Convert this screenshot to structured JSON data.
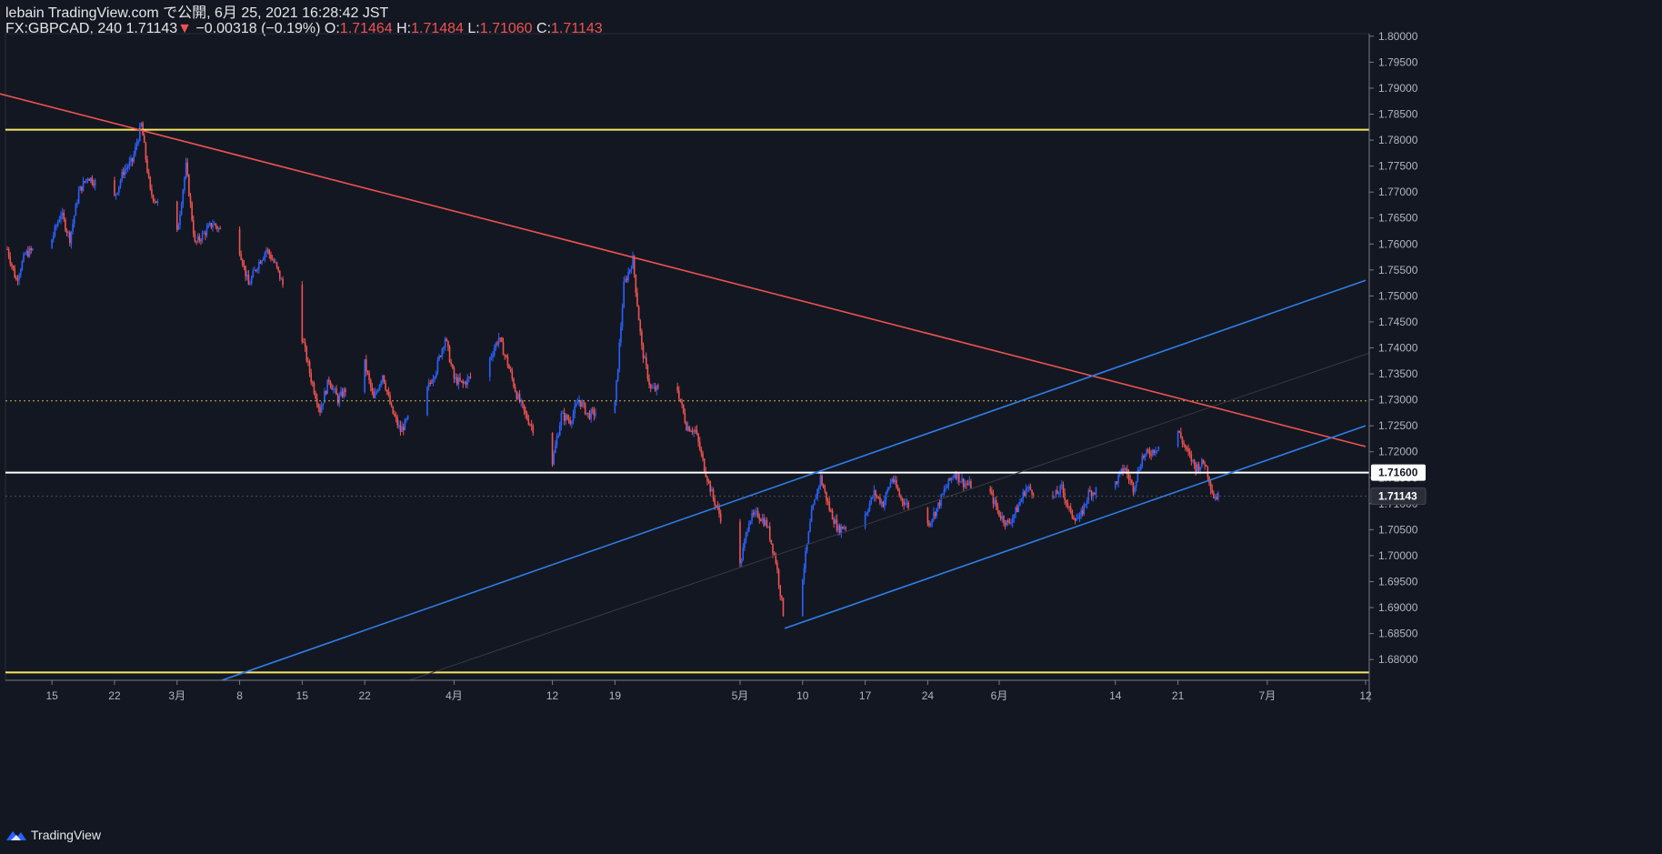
{
  "header": {
    "publisher": "lebain TradingView.com で公開, 6月 25, 2021 16:28:42 JST",
    "symbol": "FX:GBPCAD, 240",
    "last": "1.71143",
    "change": "−0.00318 (−0.19%)",
    "o_label": "O:",
    "o_value": "1.71464",
    "h_label": "H:",
    "h_value": "1.71484",
    "l_label": "L:",
    "l_value": "1.71060",
    "c_label": "C:",
    "c_value": "1.71143"
  },
  "footer": {
    "brand": "TradingView",
    "logo_icon": "tradingview-logo-icon"
  },
  "colors": {
    "background": "#131722",
    "up": "#2962ff",
    "down": "#ef5350",
    "support": "#f5e663",
    "channel": "#2f7ee6",
    "trendline": "#ef5350",
    "level": "#ffffff"
  },
  "chart_data": {
    "type": "candlestick",
    "symbol": "FX:GBPCAD",
    "interval": "240",
    "ylim": [
      1.676,
      1.8005
    ],
    "y_ticks": [
      "1.80000",
      "1.79500",
      "1.79000",
      "1.78500",
      "1.78000",
      "1.77500",
      "1.77000",
      "1.76500",
      "1.76000",
      "1.75500",
      "1.75000",
      "1.74500",
      "1.74000",
      "1.73500",
      "1.73000",
      "1.72500",
      "1.72000",
      "1.71500",
      "1.71000",
      "1.70500",
      "1.70000",
      "1.69500",
      "1.69000",
      "1.68500",
      "1.68000"
    ],
    "y_tick_values": [
      1.8,
      1.795,
      1.79,
      1.785,
      1.78,
      1.775,
      1.77,
      1.765,
      1.76,
      1.755,
      1.75,
      1.745,
      1.74,
      1.735,
      1.73,
      1.725,
      1.72,
      1.715,
      1.71,
      1.705,
      1.7,
      1.695,
      1.69,
      1.685,
      1.68
    ],
    "x_ticks": [
      {
        "label": "15",
        "date": "2021-02-15"
      },
      {
        "label": "22",
        "date": "2021-02-22"
      },
      {
        "label": "3月",
        "date": "2021-03-01"
      },
      {
        "label": "8",
        "date": "2021-03-08"
      },
      {
        "label": "15",
        "date": "2021-03-15"
      },
      {
        "label": "22",
        "date": "2021-03-22"
      },
      {
        "label": "4月",
        "date": "2021-04-01"
      },
      {
        "label": "12",
        "date": "2021-04-12"
      },
      {
        "label": "19",
        "date": "2021-04-19"
      },
      {
        "label": "5月",
        "date": "2021-05-03"
      },
      {
        "label": "10",
        "date": "2021-05-10"
      },
      {
        "label": "17",
        "date": "2021-05-17"
      },
      {
        "label": "24",
        "date": "2021-05-24"
      },
      {
        "label": "6月",
        "date": "2021-06-01"
      },
      {
        "label": "14",
        "date": "2021-06-14"
      },
      {
        "label": "21",
        "date": "2021-06-21"
      },
      {
        "label": "7月",
        "date": "2021-07-01"
      },
      {
        "label": "12",
        "date": "2021-07-12"
      }
    ],
    "price_path": [
      [
        "2021-02-10",
        1.759
      ],
      [
        "2021-02-11",
        1.753
      ],
      [
        "2021-02-12",
        1.758
      ],
      [
        "2021-02-15",
        1.761
      ],
      [
        "2021-02-16",
        1.766
      ],
      [
        "2021-02-17",
        1.761
      ],
      [
        "2021-02-18",
        1.77
      ],
      [
        "2021-02-19",
        1.773
      ],
      [
        "2021-02-22",
        1.769
      ],
      [
        "2021-02-23",
        1.774
      ],
      [
        "2021-02-24",
        1.776
      ],
      [
        "2021-02-25",
        1.783
      ],
      [
        "2021-02-26",
        1.77
      ],
      [
        "2021-03-01",
        1.762
      ],
      [
        "2021-03-02",
        1.775
      ],
      [
        "2021-03-03",
        1.76
      ],
      [
        "2021-03-04",
        1.762
      ],
      [
        "2021-03-05",
        1.764
      ],
      [
        "2021-03-08",
        1.759
      ],
      [
        "2021-03-09",
        1.752
      ],
      [
        "2021-03-10",
        1.756
      ],
      [
        "2021-03-11",
        1.759
      ],
      [
        "2021-03-12",
        1.756
      ],
      [
        "2021-03-15",
        1.742
      ],
      [
        "2021-03-16",
        1.734
      ],
      [
        "2021-03-17",
        1.728
      ],
      [
        "2021-03-18",
        1.734
      ],
      [
        "2021-03-19",
        1.73
      ],
      [
        "2021-03-22",
        1.737
      ],
      [
        "2021-03-23",
        1.73
      ],
      [
        "2021-03-24",
        1.735
      ],
      [
        "2021-03-25",
        1.728
      ],
      [
        "2021-03-26",
        1.724
      ],
      [
        "2021-03-29",
        1.732
      ],
      [
        "2021-03-30",
        1.736
      ],
      [
        "2021-03-31",
        1.742
      ],
      [
        "2021-04-01",
        1.734
      ],
      [
        "2021-04-02",
        1.733
      ],
      [
        "2021-04-05",
        1.738
      ],
      [
        "2021-04-06",
        1.742
      ],
      [
        "2021-04-07",
        1.737
      ],
      [
        "2021-04-08",
        1.731
      ],
      [
        "2021-04-09",
        1.727
      ],
      [
        "2021-04-12",
        1.718
      ],
      [
        "2021-04-13",
        1.727
      ],
      [
        "2021-04-14",
        1.726
      ],
      [
        "2021-04-15",
        1.73
      ],
      [
        "2021-04-16",
        1.727
      ],
      [
        "2021-04-19",
        1.729
      ],
      [
        "2021-04-20",
        1.752
      ],
      [
        "2021-04-21",
        1.757
      ],
      [
        "2021-04-22",
        1.74
      ],
      [
        "2021-04-23",
        1.732
      ],
      [
        "2021-04-26",
        1.732
      ],
      [
        "2021-04-27",
        1.725
      ],
      [
        "2021-04-28",
        1.724
      ],
      [
        "2021-04-29",
        1.717
      ],
      [
        "2021-04-30",
        1.711
      ],
      [
        "2021-05-03",
        1.698
      ],
      [
        "2021-05-04",
        1.707
      ],
      [
        "2021-05-05",
        1.708
      ],
      [
        "2021-05-06",
        1.706
      ],
      [
        "2021-05-07",
        1.699
      ],
      [
        "2021-05-08",
        1.687
      ],
      [
        "2021-05-10",
        1.696
      ],
      [
        "2021-05-11",
        1.708
      ],
      [
        "2021-05-12",
        1.715
      ],
      [
        "2021-05-13",
        1.709
      ],
      [
        "2021-05-14",
        1.705
      ],
      [
        "2021-05-17",
        1.708
      ],
      [
        "2021-05-18",
        1.712
      ],
      [
        "2021-05-19",
        1.71
      ],
      [
        "2021-05-20",
        1.715
      ],
      [
        "2021-05-21",
        1.711
      ],
      [
        "2021-05-24",
        1.706
      ],
      [
        "2021-05-25",
        1.709
      ],
      [
        "2021-05-26",
        1.713
      ],
      [
        "2021-05-27",
        1.716
      ],
      [
        "2021-05-28",
        1.714
      ],
      [
        "2021-05-31",
        1.712
      ],
      [
        "2021-06-01",
        1.708
      ],
      [
        "2021-06-02",
        1.706
      ],
      [
        "2021-06-03",
        1.709
      ],
      [
        "2021-06-04",
        1.713
      ],
      [
        "2021-06-07",
        1.711
      ],
      [
        "2021-06-08",
        1.713
      ],
      [
        "2021-06-09",
        1.708
      ],
      [
        "2021-06-10",
        1.707
      ],
      [
        "2021-06-11",
        1.712
      ],
      [
        "2021-06-14",
        1.714
      ],
      [
        "2021-06-15",
        1.717
      ],
      [
        "2021-06-16",
        1.713
      ],
      [
        "2021-06-17",
        1.719
      ],
      [
        "2021-06-18",
        1.72
      ],
      [
        "2021-06-21",
        1.724
      ],
      [
        "2021-06-22",
        1.72
      ],
      [
        "2021-06-23",
        1.717
      ],
      [
        "2021-06-24",
        1.718
      ],
      [
        "2021-06-25",
        1.7114
      ]
    ],
    "annotations": {
      "horizontal_lines": [
        {
          "price": 1.782,
          "color": "#f5e663",
          "style": "solid"
        },
        {
          "price": 1.6775,
          "color": "#f5e663",
          "style": "solid"
        },
        {
          "price": 1.716,
          "color": "#ffffff",
          "style": "solid"
        },
        {
          "price": 1.7298,
          "color": "#c9b458",
          "style": "dotted"
        },
        {
          "price": 1.71143,
          "color": "#4a4f5c",
          "style": "dotted"
        }
      ],
      "trend_lines": [
        {
          "from": [
            "2021-02-09",
            1.789
          ],
          "to": [
            "2021-07-12",
            1.721
          ],
          "color": "#ef5350"
        },
        {
          "from": [
            "2021-03-06",
            1.676
          ],
          "to": [
            "2021-07-12",
            1.753
          ],
          "color": "#2f7ee6"
        },
        {
          "from": [
            "2021-05-08",
            1.686
          ],
          "to": [
            "2021-07-12",
            1.725
          ],
          "color": "#2f7ee6"
        }
      ],
      "price_labels": [
        {
          "text": "1.71600",
          "price": 1.716,
          "style": "white-box"
        },
        {
          "text": "1.71143",
          "price": 1.71143,
          "style": "dark-box"
        }
      ]
    }
  }
}
